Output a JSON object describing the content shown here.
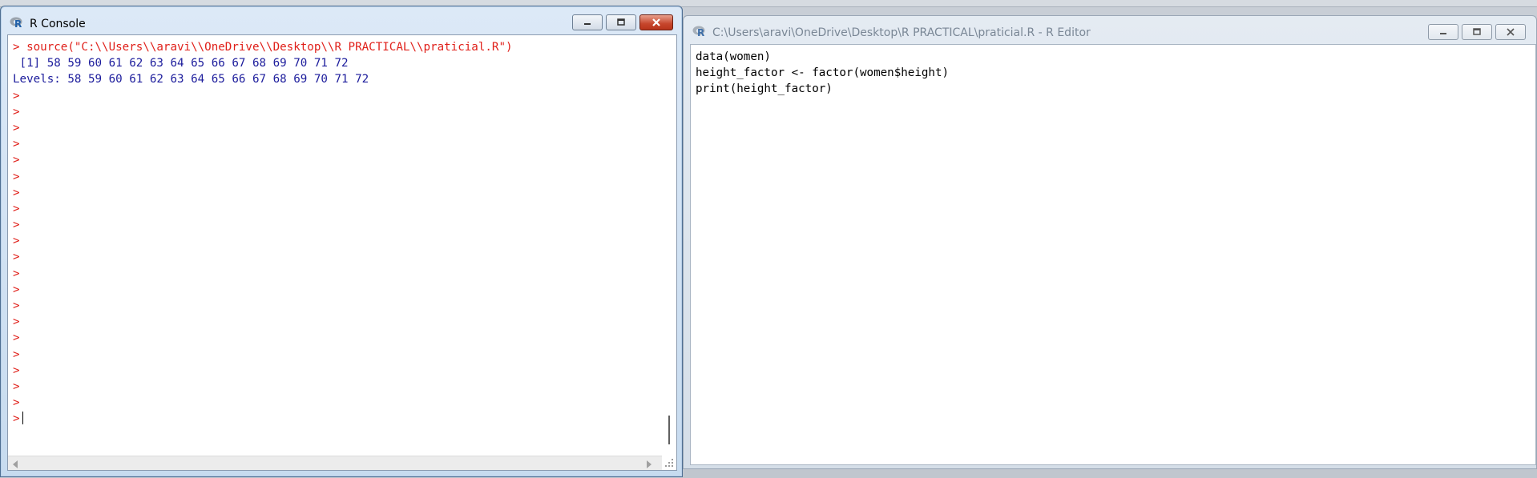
{
  "console": {
    "title": "R Console",
    "lines": [
      {
        "kind": "cmd",
        "text": "> source(\"C:\\\\Users\\\\aravi\\\\OneDrive\\\\Desktop\\\\R PRACTICAL\\\\praticial.R\")"
      },
      {
        "kind": "out",
        "text": " [1] 58 59 60 61 62 63 64 65 66 67 68 69 70 71 72"
      },
      {
        "kind": "out",
        "text": "Levels: 58 59 60 61 62 63 64 65 66 67 68 69 70 71 72"
      },
      {
        "kind": "cmd",
        "text": ">"
      },
      {
        "kind": "cmd",
        "text": ">"
      },
      {
        "kind": "cmd",
        "text": ">"
      },
      {
        "kind": "cmd",
        "text": ">"
      },
      {
        "kind": "cmd",
        "text": ">"
      },
      {
        "kind": "cmd",
        "text": ">"
      },
      {
        "kind": "cmd",
        "text": ">"
      },
      {
        "kind": "cmd",
        "text": ">"
      },
      {
        "kind": "cmd",
        "text": ">"
      },
      {
        "kind": "cmd",
        "text": ">"
      },
      {
        "kind": "cmd",
        "text": ">"
      },
      {
        "kind": "cmd",
        "text": ">"
      },
      {
        "kind": "cmd",
        "text": ">"
      },
      {
        "kind": "cmd",
        "text": ">"
      },
      {
        "kind": "cmd",
        "text": ">"
      },
      {
        "kind": "cmd",
        "text": ">"
      },
      {
        "kind": "cmd",
        "text": ">"
      },
      {
        "kind": "cmd",
        "text": ">"
      },
      {
        "kind": "cmd",
        "text": ">"
      },
      {
        "kind": "cmd",
        "text": ">"
      }
    ],
    "prompt": ">"
  },
  "editor": {
    "title": "C:\\Users\\aravi\\OneDrive\\Desktop\\R PRACTICAL\\praticial.R - R Editor",
    "lines": [
      "data(women)",
      "height_factor <- factor(women$height)",
      "print(height_factor)"
    ]
  },
  "colors": {
    "command": "#e0201a",
    "output": "#1c1c9c"
  },
  "icons": {
    "app": "r-logo-icon",
    "minimize": "minimize-icon",
    "maximize": "maximize-icon",
    "close": "close-icon"
  }
}
